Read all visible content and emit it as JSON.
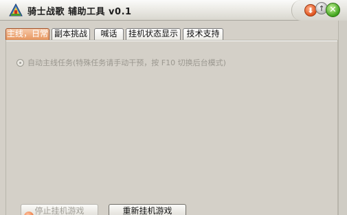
{
  "window": {
    "title": "骑士战歌 辅助工具 v0.1"
  },
  "title_controls": {
    "minimize_glyph": "⬇",
    "restore_glyph": "↑",
    "close_glyph": "✕"
  },
  "tabs": [
    {
      "label": "主线，日常",
      "active": true
    },
    {
      "label": "副本挑战",
      "active": false
    },
    {
      "label": "喊话",
      "active": false
    },
    {
      "label": "挂机状态显示",
      "active": false
    },
    {
      "label": "技术支持",
      "active": false
    }
  ],
  "main": {
    "auto_mainline_label": "自动主线任务(特殊任务请手动干预，按 F10 切换后台模式)",
    "auto_mainline_enabled": false
  },
  "buttons": {
    "stop_label": "停止挂机游戏",
    "restart_label": "重新挂机游戏"
  },
  "colors": {
    "accent_tab": "#e7965f",
    "close_green": "#3ea21c",
    "minimize_orange": "#e0541f",
    "window_bg": "#d4d0c8"
  },
  "icons": {
    "app": "knight-triangle-icon",
    "minimize": "minimize-icon",
    "restore": "restore-icon",
    "close": "close-icon"
  }
}
